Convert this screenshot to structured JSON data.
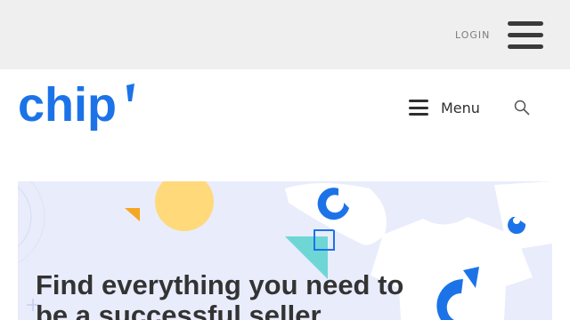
{
  "topbar": {
    "login_label": "LOGIN"
  },
  "header": {
    "logo_text": "chip",
    "menu_label": "Menu"
  },
  "hero": {
    "title": "Find everything you need to be a successful seller"
  },
  "colors": {
    "brand_blue": "#1c73e8",
    "topbar_bg": "#efefef",
    "hero_bg": "#e9ecfb",
    "accent_yellow": "#ffd97a",
    "accent_teal": "#6fd6d6",
    "accent_orange": "#f5a623"
  },
  "icons": [
    "hamburger-icon",
    "search-icon"
  ]
}
